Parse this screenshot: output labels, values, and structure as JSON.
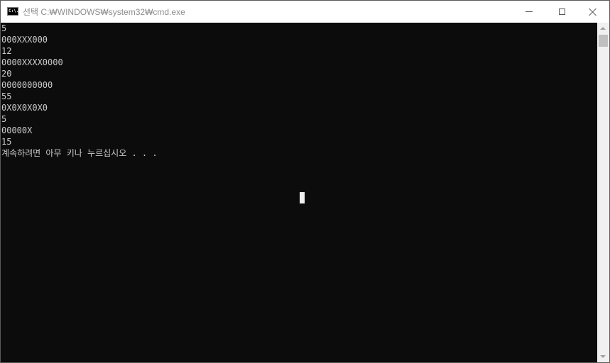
{
  "window": {
    "title": "선택 C:₩WINDOWS₩system32₩cmd.exe",
    "icon_text": "C:\\."
  },
  "console": {
    "lines": [
      "5",
      "000XXX000",
      "12",
      "0000XXXX0000",
      "20",
      "0000000000",
      "55",
      "0X0X0X0X0",
      "5",
      "00000X",
      "15",
      "계속하려면 아무 키나 누르십시오 . . ."
    ]
  },
  "icons": {
    "minimize": "minimize-icon",
    "maximize": "maximize-icon",
    "close": "close-icon"
  },
  "colors": {
    "console_bg": "#0c0c0c",
    "console_text": "#cccccc",
    "title_text": "#8c8c8c"
  }
}
